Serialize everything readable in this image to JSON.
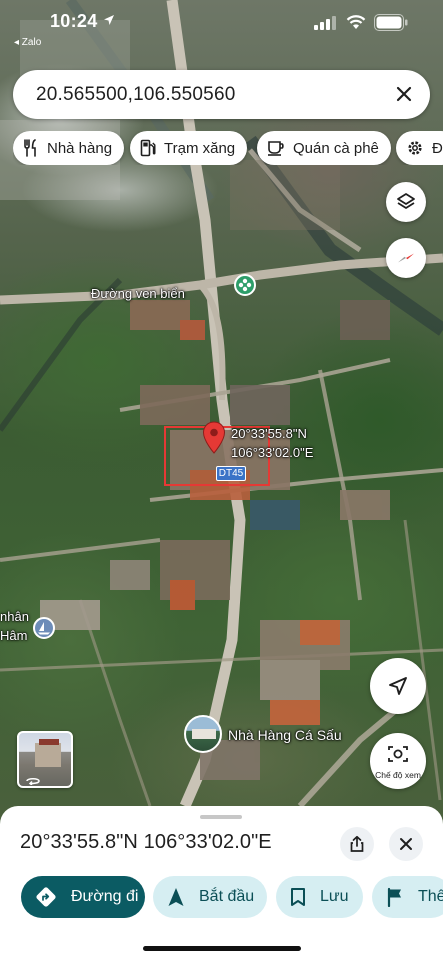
{
  "status_bar": {
    "time": "10:24",
    "back_app": "◂ Zalo"
  },
  "search": {
    "query": "20.565500,106.550560",
    "close_icon": "close-icon"
  },
  "chips": [
    {
      "label": "Nhà hàng",
      "icon": "restaurant-icon"
    },
    {
      "label": "Trạm xăng",
      "icon": "gas-station-icon"
    },
    {
      "label": "Quán cà phê",
      "icon": "coffee-icon"
    },
    {
      "label": "Đị",
      "icon": "gear-icon"
    }
  ],
  "map": {
    "road_label": "Đường ven biển",
    "pin_coord_line1": "20°33'55.8\"N",
    "pin_coord_line2": "106°33'02.0\"E",
    "route_shield": "DT45",
    "left_edge_label_1": "nhân",
    "left_edge_label_2": "Hâm",
    "place_label": "Nhà Hàng Cá Sấu",
    "street_view_label": "Chế độ xem",
    "colors": {
      "pin": "#e53935",
      "selection_box": "#e53935",
      "shield": "#3b73c7",
      "poi_green": "#2e9e6a"
    }
  },
  "sheet": {
    "coordinates": "20°33'55.8\"N 106°33'02.0\"E",
    "share_icon": "share-icon",
    "close_icon": "close-icon",
    "actions": [
      {
        "label": "Đường đi",
        "icon": "directions-icon",
        "style": "primary"
      },
      {
        "label": "Bắt đầu",
        "icon": "navigation-arrow-icon",
        "style": "secondary"
      },
      {
        "label": "Lưu",
        "icon": "bookmark-icon",
        "style": "secondary"
      },
      {
        "label": "Thê",
        "icon": "flag-icon",
        "style": "secondary"
      }
    ],
    "colors": {
      "primary": "#0b5b63",
      "secondary": "#d6eef2"
    }
  }
}
